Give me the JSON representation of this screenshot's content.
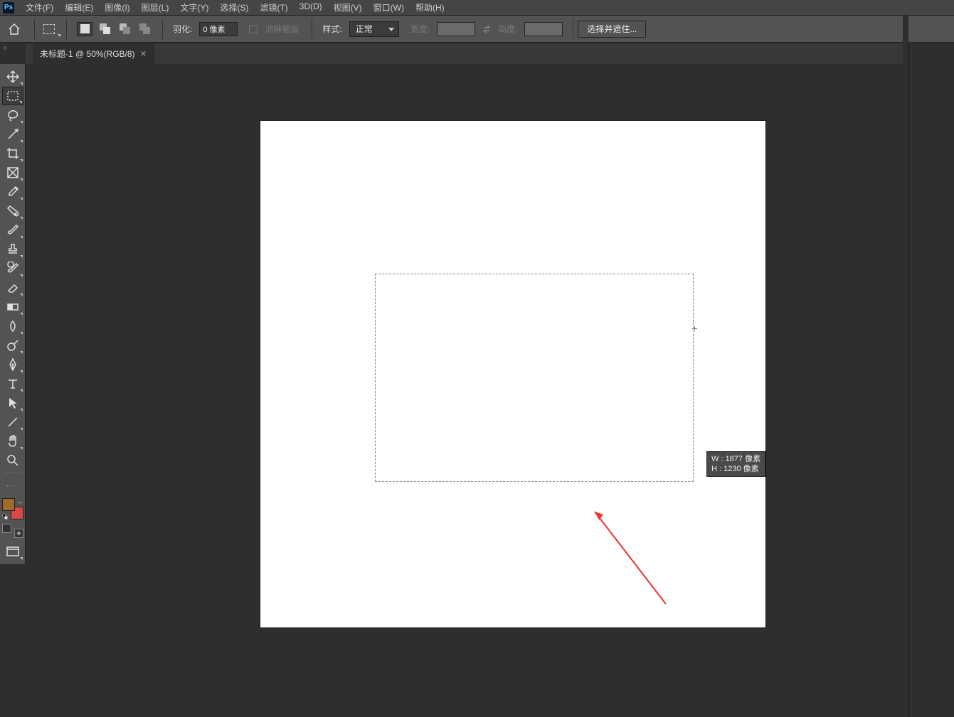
{
  "menu": {
    "items": [
      "文件(F)",
      "编辑(E)",
      "图像(I)",
      "图层(L)",
      "文字(Y)",
      "选择(S)",
      "滤镜(T)",
      "3D(D)",
      "视图(V)",
      "窗口(W)",
      "帮助(H)"
    ]
  },
  "options": {
    "feather_label": "羽化:",
    "feather_value": "0 像素",
    "antialias_label": "消除锯齿",
    "style_label": "样式:",
    "style_value": "正常",
    "width_label": "宽度:",
    "height_label": "高度:",
    "select_mask_btn": "选择并遮住..."
  },
  "tab": {
    "title": "未标题-1 @ 50%(RGB/8)"
  },
  "colors": {
    "foreground": "#a16a2f",
    "background": "#d84a4a"
  },
  "selection_tooltip": {
    "w_label": "W :",
    "w_value": "1877 像素",
    "h_label": "H :",
    "h_value": "1230 像素"
  },
  "tools": [
    {
      "name": "move-tool",
      "icon": "move",
      "corner": true
    },
    {
      "name": "rectangular-marquee-tool",
      "icon": "marquee",
      "corner": true,
      "selected": true
    },
    {
      "name": "lasso-tool",
      "icon": "lasso",
      "corner": true
    },
    {
      "name": "quick-selection-tool",
      "icon": "wand",
      "corner": true
    },
    {
      "name": "crop-tool",
      "icon": "crop",
      "corner": true
    },
    {
      "name": "frame-tool",
      "icon": "frame",
      "corner": true
    },
    {
      "name": "eyedropper-tool",
      "icon": "eyedrop",
      "corner": true
    },
    {
      "name": "spot-healing-tool",
      "icon": "heal",
      "corner": true
    },
    {
      "name": "brush-tool",
      "icon": "brush",
      "corner": true
    },
    {
      "name": "clone-stamp-tool",
      "icon": "stamp",
      "corner": true
    },
    {
      "name": "history-brush-tool",
      "icon": "histbrush",
      "corner": true
    },
    {
      "name": "eraser-tool",
      "icon": "eraser",
      "corner": true
    },
    {
      "name": "gradient-tool",
      "icon": "gradient",
      "corner": true
    },
    {
      "name": "blur-tool",
      "icon": "blur",
      "corner": true
    },
    {
      "name": "dodge-tool",
      "icon": "dodge",
      "corner": true
    },
    {
      "name": "pen-tool",
      "icon": "pen",
      "corner": true
    },
    {
      "name": "type-tool",
      "icon": "type",
      "corner": true
    },
    {
      "name": "path-selection-tool",
      "icon": "pathsel",
      "corner": true
    },
    {
      "name": "line-tool",
      "icon": "line",
      "corner": true
    },
    {
      "name": "hand-tool",
      "icon": "hand",
      "corner": true
    },
    {
      "name": "zoom-tool",
      "icon": "zoom",
      "corner": false
    }
  ]
}
